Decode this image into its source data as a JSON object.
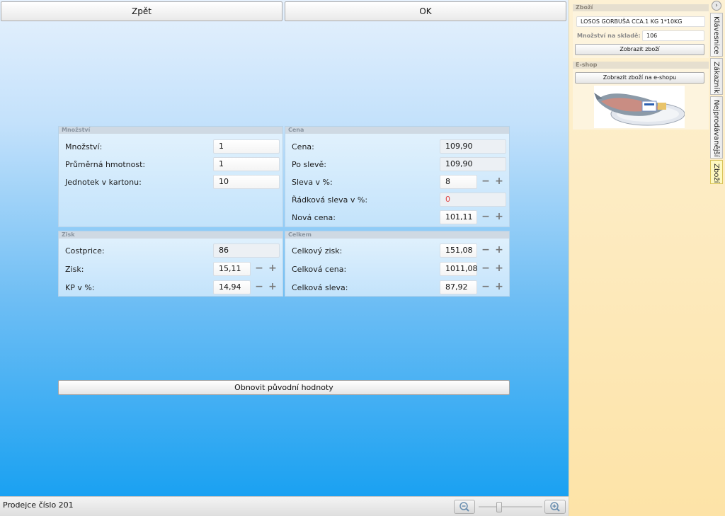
{
  "toolbar": {
    "back_label": "Zpět",
    "ok_label": "OK"
  },
  "panels": {
    "mnozstvi": {
      "title": "Množství",
      "rows": [
        {
          "label": "Množství:",
          "value": "1"
        },
        {
          "label": "Průměrná hmotnost:",
          "value": "1"
        },
        {
          "label": "Jednotek v kartonu:",
          "value": "10"
        }
      ]
    },
    "cena": {
      "title": "Cena",
      "rows": [
        {
          "label": "Cena:",
          "value": "109,90"
        },
        {
          "label": "Po slevě:",
          "value": "109,90"
        },
        {
          "label": "Sleva v %:",
          "value": "8"
        },
        {
          "label": "Řádková sleva v %:",
          "value": "0"
        },
        {
          "label": "Nová cena:",
          "value": "101,11"
        }
      ]
    },
    "zisk": {
      "title": "Zisk",
      "rows": [
        {
          "label": "Costprice:",
          "value": "86"
        },
        {
          "label": "Zisk:",
          "value": "15,11"
        },
        {
          "label": "KP v %:",
          "value": "14,94"
        }
      ]
    },
    "celkem": {
      "title": "Celkem",
      "rows": [
        {
          "label": "Celkový zisk:",
          "value": "151,08"
        },
        {
          "label": "Celková cena:",
          "value": "1011,08"
        },
        {
          "label": "Celková sleva:",
          "value": "87,92"
        }
      ]
    }
  },
  "reset_label": "Obnovit původní hodnoty",
  "status": {
    "text": "Prodejce číslo 201"
  },
  "sidebar": {
    "zbozi": {
      "title": "Zboží",
      "product_name": "LOSOS GORBUŠA CCA.1 KG 1*10KG",
      "stock_label": "Množství na skladě:",
      "stock_value": "106",
      "show_button": "Zobrazit zboží"
    },
    "eshop": {
      "title": "E-shop",
      "show_button": "Zobrazit zboží na e-shopu"
    },
    "tabs": [
      "Klávesnice",
      "Zákazník",
      "Nejprodávanější",
      "Zboží"
    ],
    "collapse_icon": "chevron-right-icon"
  },
  "colors": {
    "accent_blue": "#1aa1f2",
    "sidebar_bg": "#fde3a7",
    "warning_value": "#e04040"
  }
}
